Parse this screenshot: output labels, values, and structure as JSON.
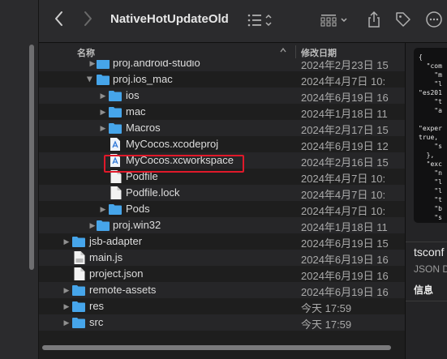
{
  "toolbar": {
    "title": "NativeHotUpdateOld",
    "back_icon": "chevron-left-icon",
    "forward_icon": "chevron-right-icon",
    "view_icon": "list-view-icon",
    "group_icon": "grid-group-icon",
    "share_icon": "share-icon",
    "tag_icon": "tag-icon",
    "more_icon": "ellipsis-circle-icon"
  },
  "columns": {
    "name": "名称",
    "date": "修改日期"
  },
  "rows": [
    {
      "name": "proj.android-studio",
      "date": "2024年2月23日 15",
      "type": "folder",
      "expanded": false
    },
    {
      "name": "proj.ios_mac",
      "date": "2024年4月7日 10:",
      "type": "folder",
      "expanded": true
    },
    {
      "name": "ios",
      "date": "2024年6月19日 16",
      "type": "folder",
      "expanded": false
    },
    {
      "name": "mac",
      "date": "2024年1月18日 11",
      "type": "folder",
      "expanded": false
    },
    {
      "name": "Macros",
      "date": "2024年2月17日 15",
      "type": "folder",
      "expanded": false
    },
    {
      "name": "MyCocos.xcodeproj",
      "date": "2024年6月19日 12",
      "type": "xcode"
    },
    {
      "name": "MyCocos.xcworkspace",
      "date": "2024年2月16日 15",
      "type": "xcode"
    },
    {
      "name": "Podfile",
      "date": "2024年4月7日 10:",
      "type": "file"
    },
    {
      "name": "Podfile.lock",
      "date": "2024年4月7日 10:",
      "type": "file"
    },
    {
      "name": "Pods",
      "date": "2024年4月7日 10:",
      "type": "folder",
      "expanded": false
    },
    {
      "name": "proj.win32",
      "date": "2024年1月18日 11",
      "type": "folder",
      "expanded": false
    },
    {
      "name": "jsb-adapter",
      "date": "2024年6月19日 15",
      "type": "folder",
      "expanded": false
    },
    {
      "name": "main.js",
      "date": "2024年6月19日 16",
      "type": "jsfile"
    },
    {
      "name": "project.json",
      "date": "2024年6月19日 16",
      "type": "file"
    },
    {
      "name": "remote-assets",
      "date": "2024年6月19日 16",
      "type": "folder",
      "expanded": false
    },
    {
      "name": "res",
      "date": "今天 17:59",
      "type": "folder",
      "expanded": false
    },
    {
      "name": "src",
      "date": "今天 17:59",
      "type": "folder",
      "expanded": false
    }
  ],
  "preview": {
    "code": "{\n  \"com\n    \"m\n    \"l\n\"es201\n    \"t\n    \"a\n\n\"exper\ntrue,\n    \"s\n  },\n  \"exc\n    \"n\n    \"l\n    \"l\n    \"t\n    \"b\n    \"s",
    "file_name": "tsconf",
    "file_kind": "JSON D",
    "info_heading": "信息"
  },
  "colors": {
    "folder": "#46a5ea",
    "highlight": "#e0192a"
  }
}
